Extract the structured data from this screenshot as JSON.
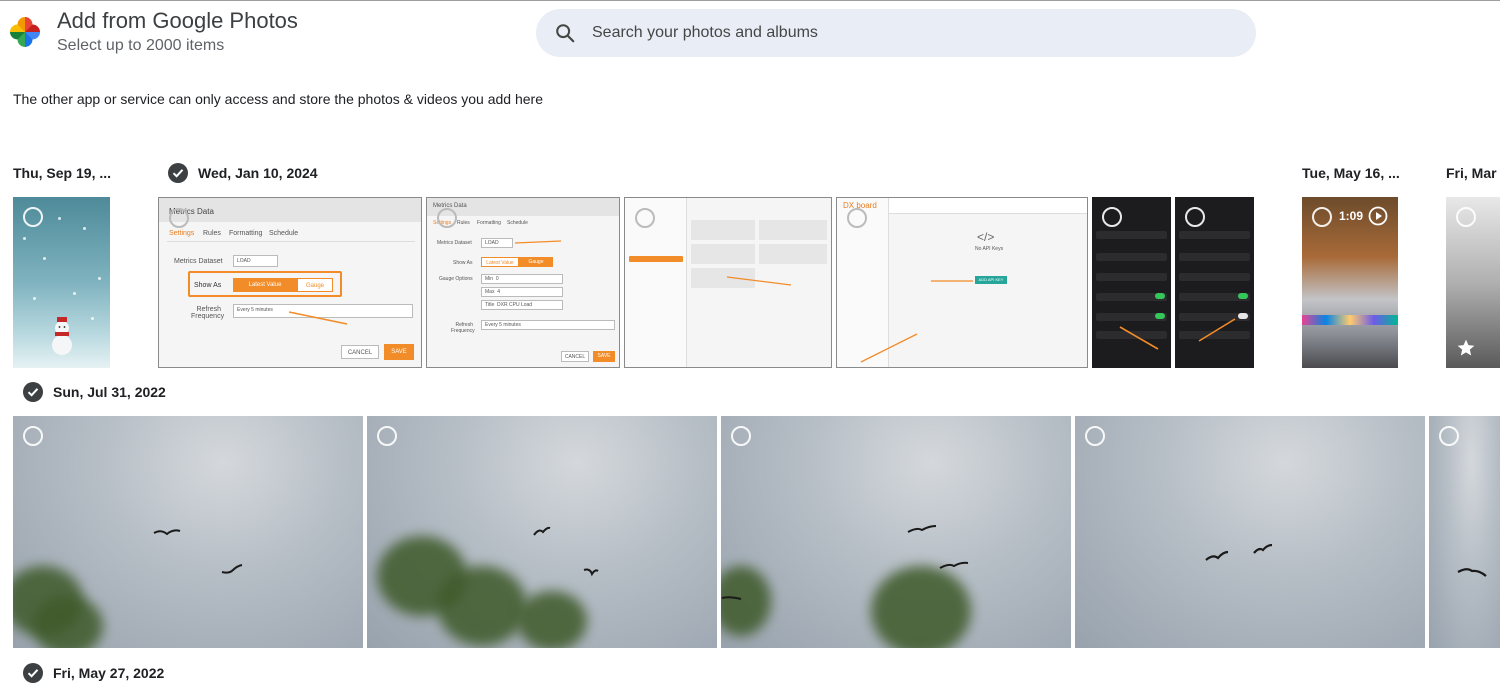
{
  "header": {
    "title": "Add from Google Photos",
    "subtitle": "Select up to 2000 items"
  },
  "search": {
    "placeholder": "Search your photos and albums",
    "value": ""
  },
  "notice": "The other app or service can only access and store the photos & videos you add here",
  "groups": [
    {
      "date": "Thu, Sep 19, ...",
      "selected": false
    },
    {
      "date": "Wed, Jan 10, 2024",
      "selected": true
    },
    {
      "date": "Tue, May 16, ...",
      "selected": false
    },
    {
      "date": "Fri, Mar",
      "selected": false
    },
    {
      "date": "Sun, Jul 31, 2022",
      "selected": true
    },
    {
      "date": "Fri, May 27, 2022",
      "selected": true
    }
  ],
  "video": {
    "duration": "1:09"
  },
  "screenshots": {
    "metrics1": {
      "title": "Metrics Data",
      "tabs": [
        "Settings",
        "Rules",
        "Formatting",
        "Schedule"
      ],
      "dataset_label": "Metrics Dataset",
      "dataset_value": "LOAD",
      "show_as_label": "Show As",
      "opt_latest": "Latest Value",
      "opt_gauge": "Gauge",
      "refresh_label": "Refresh Frequency",
      "refresh_value": "Every 5 minutes",
      "cancel": "CANCEL",
      "save": "SAVE"
    },
    "metrics2": {
      "title": "Metrics Data",
      "tabs": [
        "Settings",
        "Rules",
        "Formatting",
        "Schedule"
      ],
      "dataset_label": "Metrics Dataset",
      "dataset_value": "LOAD",
      "show_as_label": "Show As",
      "opt_latest": "Latest Value",
      "opt_gauge": "Gauge",
      "gauge_label": "Gauge Options",
      "min_label": "Min",
      "min_value": "0",
      "max_label": "Max",
      "max_value": "4",
      "title_label": "Title",
      "title_value": "DXR CPU Load",
      "refresh_label": "Refresh Frequency",
      "refresh_value": "Every 5 minutes",
      "cancel": "CANCEL",
      "save": "SAVE"
    },
    "dashboard": {
      "brand": "DX board",
      "empty": "No API Keys",
      "add_btn": "ADD API KEY"
    }
  },
  "colors": {
    "accent_orange": "#f28c28",
    "search_bg": "#e9eef6",
    "check_dark": "#3c4043"
  }
}
